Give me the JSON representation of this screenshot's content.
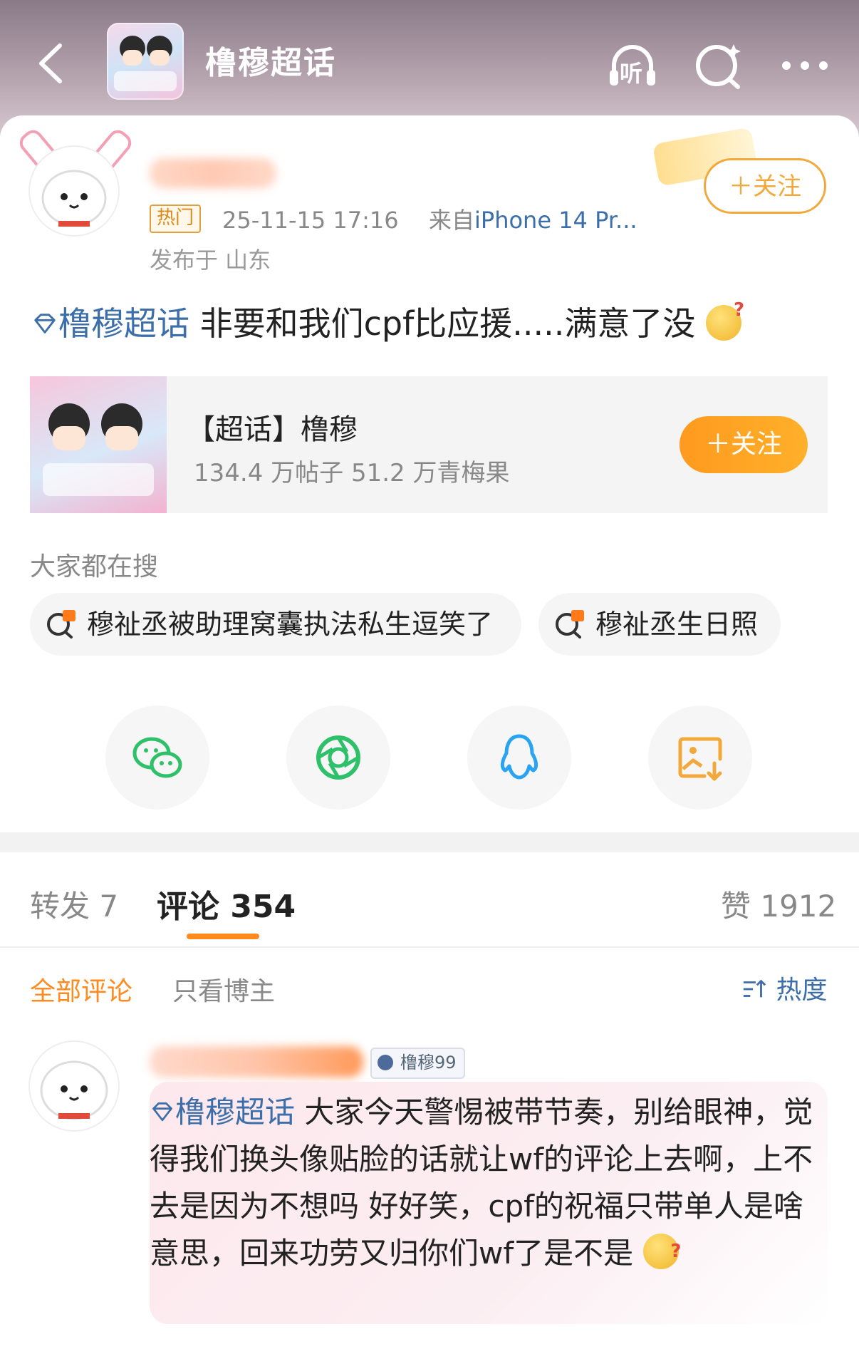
{
  "header": {
    "title": "橹穆超话",
    "icons": [
      "back-icon",
      "listen-icon",
      "search-icon",
      "more-icon"
    ],
    "listen_label": "听"
  },
  "post": {
    "hot_tag": "热门",
    "datetime": "25-11-15 17:16",
    "from_prefix": "来自",
    "device": "iPhone 14 Pr...",
    "location": "发布于 山东",
    "follow_label": "＋关注",
    "topic_link": "橹穆超话",
    "text": " 非要和我们cpf比应援.....满意了没"
  },
  "topic_card": {
    "name": "【超话】橹穆",
    "stats": "134.4 万帖子 51.2 万青梅果",
    "follow_label": "＋关注"
  },
  "trending": {
    "label": "大家都在搜",
    "items": [
      {
        "text": "穆祉丞被助理窝囊执法私生逗笑了"
      },
      {
        "text": "穆祉丞生日照"
      }
    ]
  },
  "share": [
    "wechat-icon",
    "moments-icon",
    "qq-icon",
    "save-image-icon"
  ],
  "tabs": {
    "repost": "转发 7",
    "comment": "评论 354",
    "like": "赞 1912"
  },
  "filters": {
    "all": "全部评论",
    "owner_only": "只看博主",
    "sort": "热度"
  },
  "comment": {
    "badge": "橹穆99",
    "topic_link": "橹穆超话",
    "text": " 大家今天警惕被带节奏，别给眼神，觉得我们换头像贴脸的话就让wf的评论上去啊，上不去是因为不想吗 好好笑，cpf的祝福只带单人是啥意思，回来功劳又归你们wf了是不是"
  },
  "colors": {
    "accent": "#ff8a1e",
    "link": "#3c6eaa",
    "follow_outline": "#f2a83a"
  }
}
